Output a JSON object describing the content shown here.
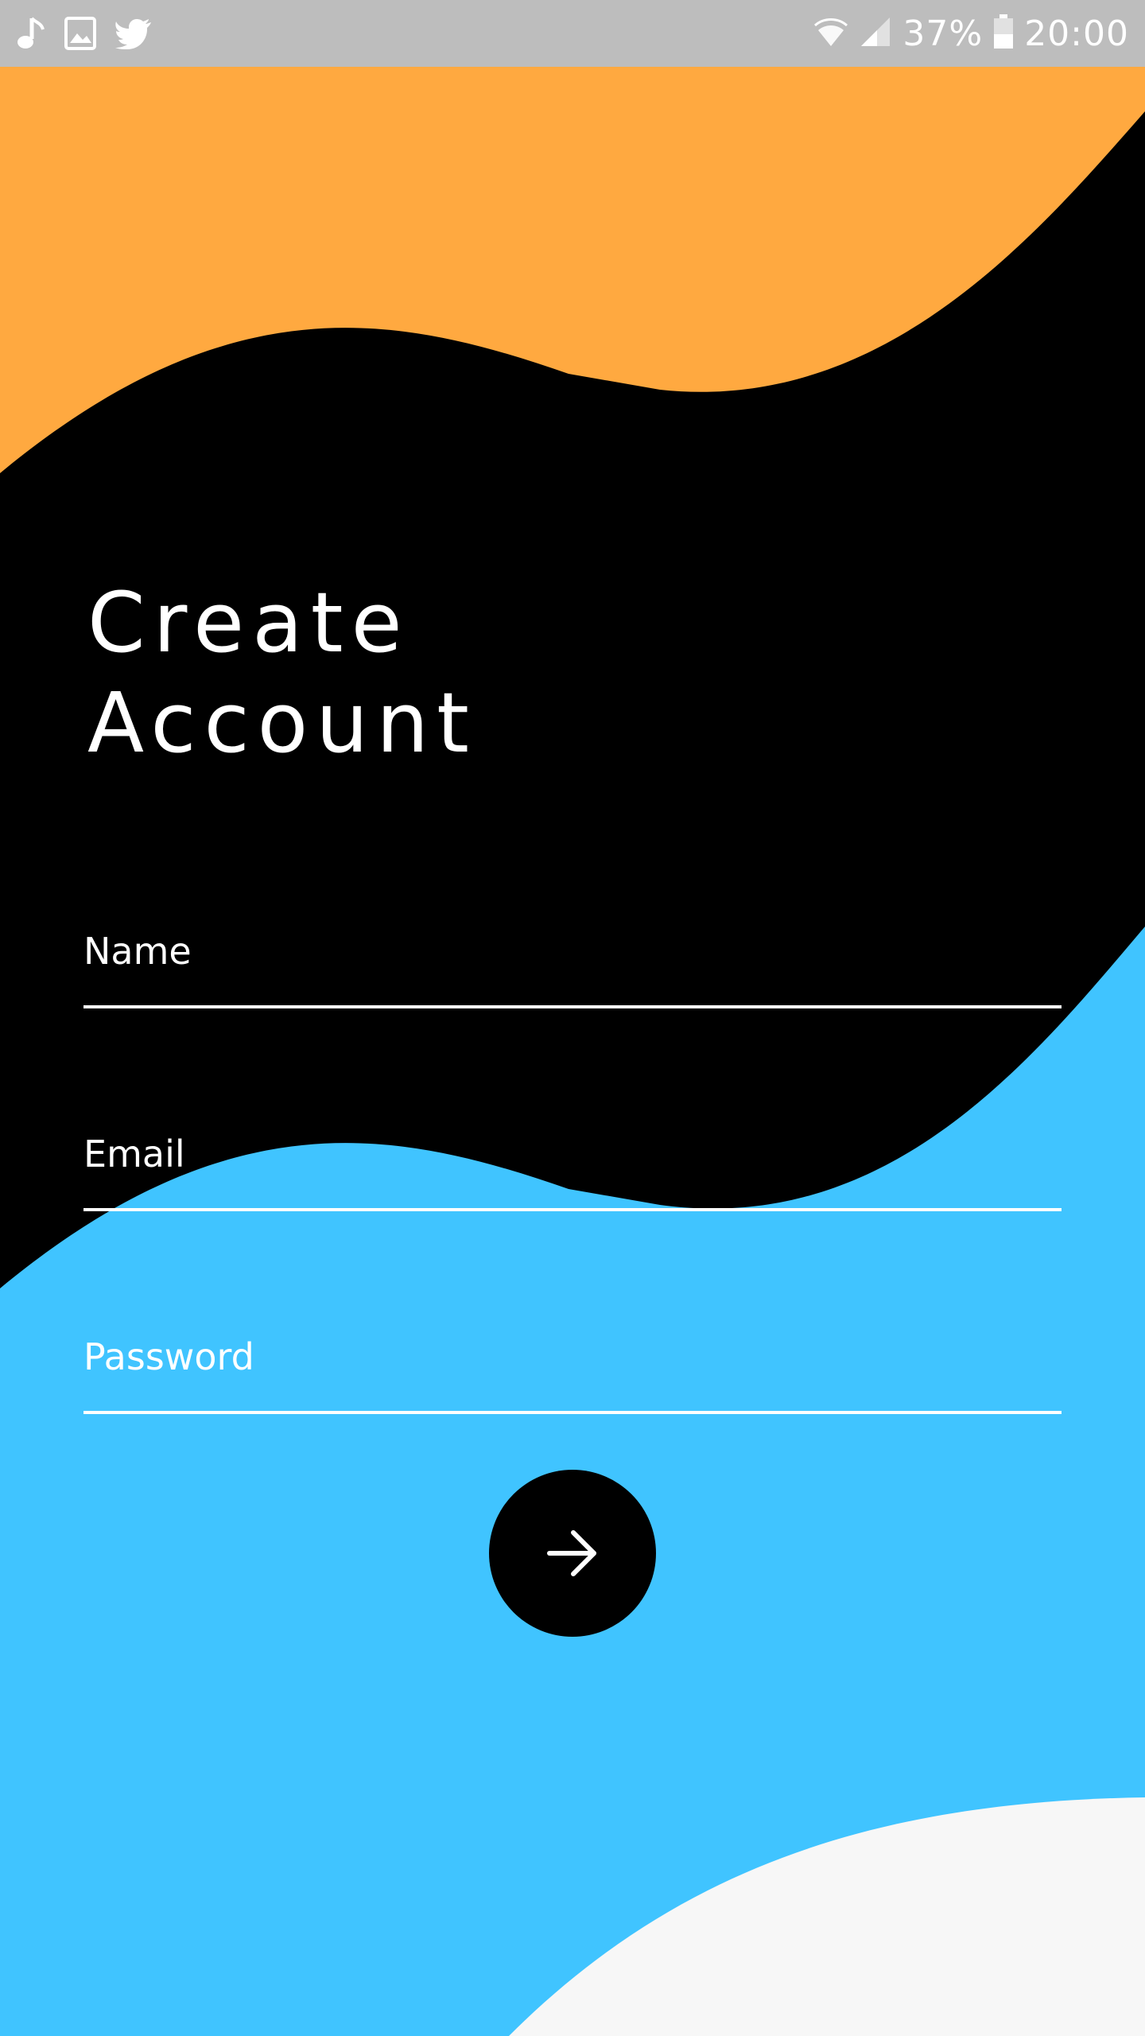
{
  "status_bar": {
    "left_icons": [
      "music-note-icon",
      "image-icon",
      "twitter-icon"
    ],
    "battery_percent": "37%",
    "time": "20:00",
    "right_icons": [
      "wifi-icon",
      "signal-icon",
      "battery-icon"
    ]
  },
  "title": {
    "line1": "Create",
    "line2": "Account"
  },
  "form": {
    "name_placeholder": "Name",
    "email_placeholder": "Email",
    "password_placeholder": "Password",
    "submit_icon": "arrow-right-icon"
  },
  "colors": {
    "status_bar": "#bdbdbd",
    "orange": "#ffa940",
    "black": "#000000",
    "blue": "#40c4ff",
    "light": "#f7f7f7",
    "text": "#ffffff"
  }
}
